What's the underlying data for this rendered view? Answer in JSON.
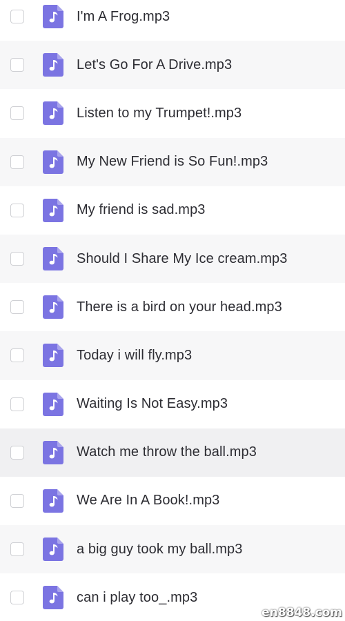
{
  "colors": {
    "icon": "#7b74e2",
    "text": "#2d2d33",
    "alt_row": "#f7f7f8",
    "hover_row": "#f0f0f2",
    "checkbox_border": "#cfd0d4"
  },
  "files": [
    {
      "name": "I'm A Frog.mp3",
      "icon": "audio-file-icon"
    },
    {
      "name": "Let's Go For A Drive.mp3",
      "icon": "audio-file-icon"
    },
    {
      "name": "Listen to my Trumpet!.mp3",
      "icon": "audio-file-icon"
    },
    {
      "name": "My New Friend is So Fun!.mp3",
      "icon": "audio-file-icon"
    },
    {
      "name": "My friend is sad.mp3",
      "icon": "audio-file-icon"
    },
    {
      "name": "Should I Share My Ice cream.mp3",
      "icon": "audio-file-icon"
    },
    {
      "name": "There is a bird on your head.mp3",
      "icon": "audio-file-icon"
    },
    {
      "name": "Today i will fly.mp3",
      "icon": "audio-file-icon"
    },
    {
      "name": "Waiting Is Not Easy.mp3",
      "icon": "audio-file-icon"
    },
    {
      "name": "Watch me throw the ball.mp3",
      "icon": "audio-file-icon"
    },
    {
      "name": "We Are In A Book!.mp3",
      "icon": "audio-file-icon"
    },
    {
      "name": "a big guy took my ball.mp3",
      "icon": "audio-file-icon"
    },
    {
      "name": "can i play too_.mp3",
      "icon": "audio-file-icon"
    }
  ],
  "watermark": "en8848.com"
}
